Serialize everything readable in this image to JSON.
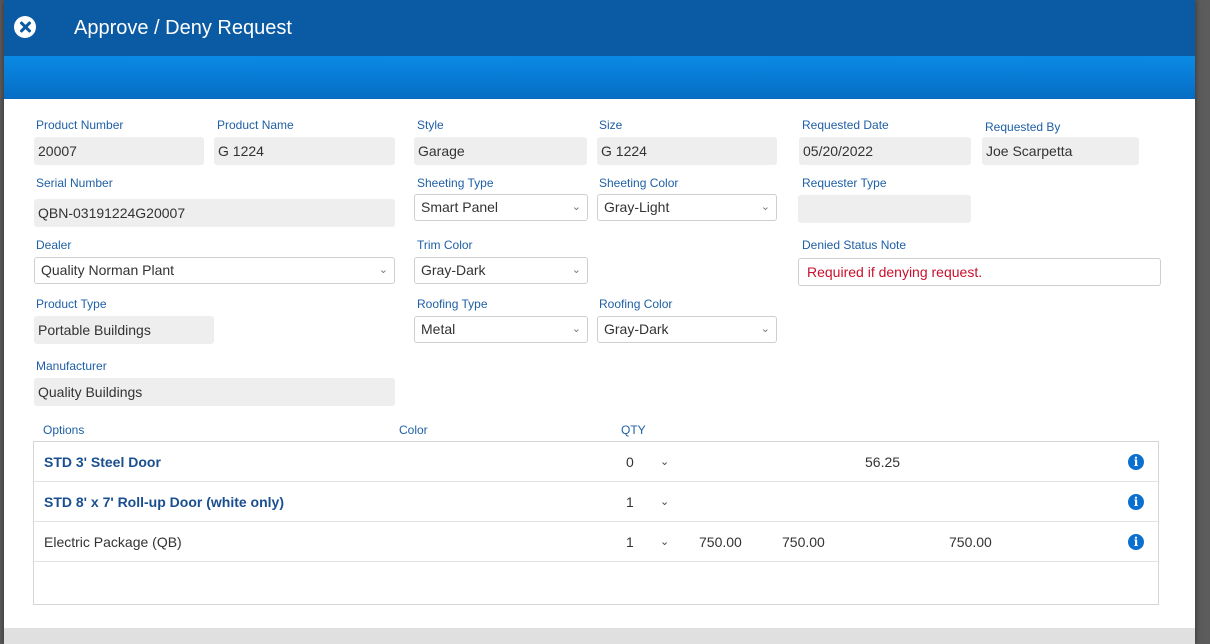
{
  "dialog": {
    "title": "Approve / Deny Request"
  },
  "form": {
    "product_number": {
      "label": "Product Number",
      "value": "20007"
    },
    "product_name": {
      "label": "Product Name",
      "value": "G 1224"
    },
    "style": {
      "label": "Style",
      "value": "Garage"
    },
    "size": {
      "label": "Size",
      "value": "G 1224"
    },
    "requested_date": {
      "label": "Requested Date",
      "value": "05/20/2022"
    },
    "requested_by": {
      "label": "Requested By",
      "value": "Joe Scarpetta"
    },
    "serial_number": {
      "label": "Serial Number",
      "value": "QBN-03191224G20007"
    },
    "sheeting_type": {
      "label": "Sheeting Type",
      "value": "Smart Panel"
    },
    "sheeting_color": {
      "label": "Sheeting Color",
      "value": "Gray-Light"
    },
    "requester_type": {
      "label": "Requester Type",
      "value": ""
    },
    "dealer": {
      "label": "Dealer",
      "value": "Quality Norman Plant"
    },
    "trim_color": {
      "label": "Trim Color",
      "value": "Gray-Dark"
    },
    "denied_status_note": {
      "label": "Denied Status Note",
      "placeholder": "Required if denying request."
    },
    "product_type": {
      "label": "Product Type",
      "value": "Portable Buildings"
    },
    "roofing_type": {
      "label": "Roofing Type",
      "value": "Metal"
    },
    "roofing_color": {
      "label": "Roofing Color",
      "value": "Gray-Dark"
    },
    "manufacturer": {
      "label": "Manufacturer",
      "value": "Quality Buildings"
    }
  },
  "options_table": {
    "headers": {
      "options": "Options",
      "color": "Color",
      "qty": "QTY"
    },
    "rows": [
      {
        "name": "STD 3' Steel Door",
        "qty": "0",
        "price": "",
        "total": "",
        "value": "56.25"
      },
      {
        "name": "STD 8' x 7' Roll-up Door (white only)",
        "qty": "1",
        "price": "",
        "total": "",
        "value": ""
      },
      {
        "name": "Electric Package (QB)",
        "qty": "1",
        "price": "750.00",
        "total": "750.00",
        "value": "750.00"
      }
    ]
  },
  "colors": {
    "header": "#0b5aa4",
    "subheader": "#0a8ae6",
    "label": "#1f5fa6",
    "required_note": "#c8102e"
  }
}
